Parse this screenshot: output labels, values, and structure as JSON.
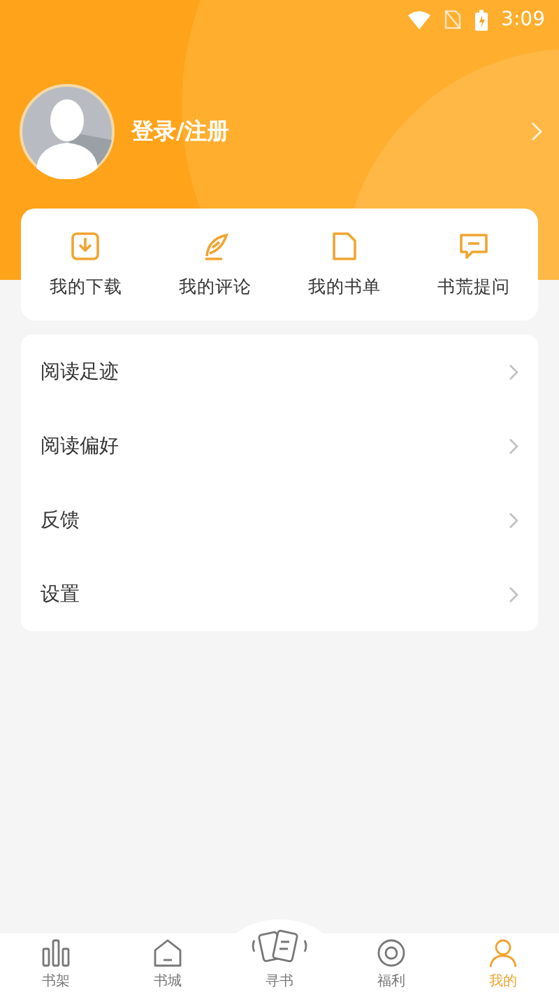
{
  "status_bar": {
    "time": "3:09"
  },
  "profile": {
    "login": "登录/注册"
  },
  "shortcuts": [
    {
      "label": "我的下载",
      "kind": "download"
    },
    {
      "label": "我的评论",
      "kind": "feather"
    },
    {
      "label": "我的书单",
      "kind": "page"
    },
    {
      "label": "书荒提问",
      "kind": "chat"
    }
  ],
  "menu": [
    {
      "label": "阅读足迹"
    },
    {
      "label": "阅读偏好"
    },
    {
      "label": "反馈"
    },
    {
      "label": "设置"
    }
  ],
  "tabs": [
    {
      "label": "书架",
      "kind": "shelf",
      "selected": false
    },
    {
      "label": "书城",
      "kind": "home",
      "selected": false
    },
    {
      "label": "寻书",
      "kind": "cards",
      "selected": false
    },
    {
      "label": "福利",
      "kind": "gift",
      "selected": false
    },
    {
      "label": "我的",
      "kind": "me",
      "selected": true
    }
  ]
}
